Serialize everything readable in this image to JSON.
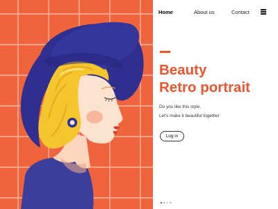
{
  "nav": {
    "items": [
      {
        "label": "Home",
        "active": true
      },
      {
        "label": "About us",
        "active": false
      },
      {
        "label": "Contact",
        "active": false
      }
    ],
    "menu_icon": "hamburger-menu-icon"
  },
  "hero": {
    "title_line1": "Beauty",
    "title_line2": "Retro portrait",
    "subtitle_line1": "Do you like this style,",
    "subtitle_line2": "Let's make it beautiful together",
    "login_label": "Log in"
  },
  "pager": {
    "count": 4,
    "active_index": 0
  },
  "colors": {
    "accent": "#e8552f",
    "tile": "#f0643d",
    "grout": "#f6b8a2",
    "hat": "#2e2f8f",
    "hair": "#f4c52c",
    "skin": "#fbe3d0",
    "dress": "#3b3e9a",
    "text": "#222222"
  }
}
